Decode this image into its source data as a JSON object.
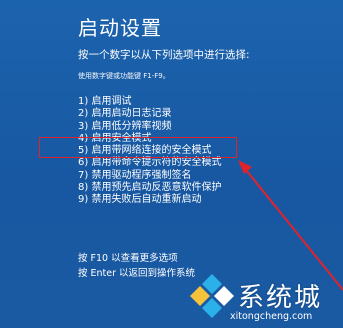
{
  "screen": {
    "title": "启动设置",
    "instruction": "按一个数字以从下列选项中进行选择:",
    "hint": "使用数字键或功能键 F1-F9。"
  },
  "options": [
    {
      "label": "1) 启用调试"
    },
    {
      "label": "2) 启用启动日志记录"
    },
    {
      "label": "3) 启用低分辨率视频"
    },
    {
      "label": "4) 启用安全模式"
    },
    {
      "label": "5) 启用带网络连接的安全模式"
    },
    {
      "label": "6) 启用带命令提示符的安全模式"
    },
    {
      "label": "7) 禁用驱动程序强制签名"
    },
    {
      "label": "8) 禁用预先启动反恶意软件保护"
    },
    {
      "label": "9) 禁用失败后自动重新启动"
    }
  ],
  "footer": {
    "more_options": "按 F10 以查看更多选项",
    "return": "按 Enter 以返回到操作系统"
  },
  "watermark": {
    "name": "系统城",
    "url": "xitongcheng.com",
    "logo_icon": "diamond-logo-icon"
  },
  "colors": {
    "background": "#1a5ea6",
    "highlight": "#e0232b",
    "text": "#ffffff"
  }
}
